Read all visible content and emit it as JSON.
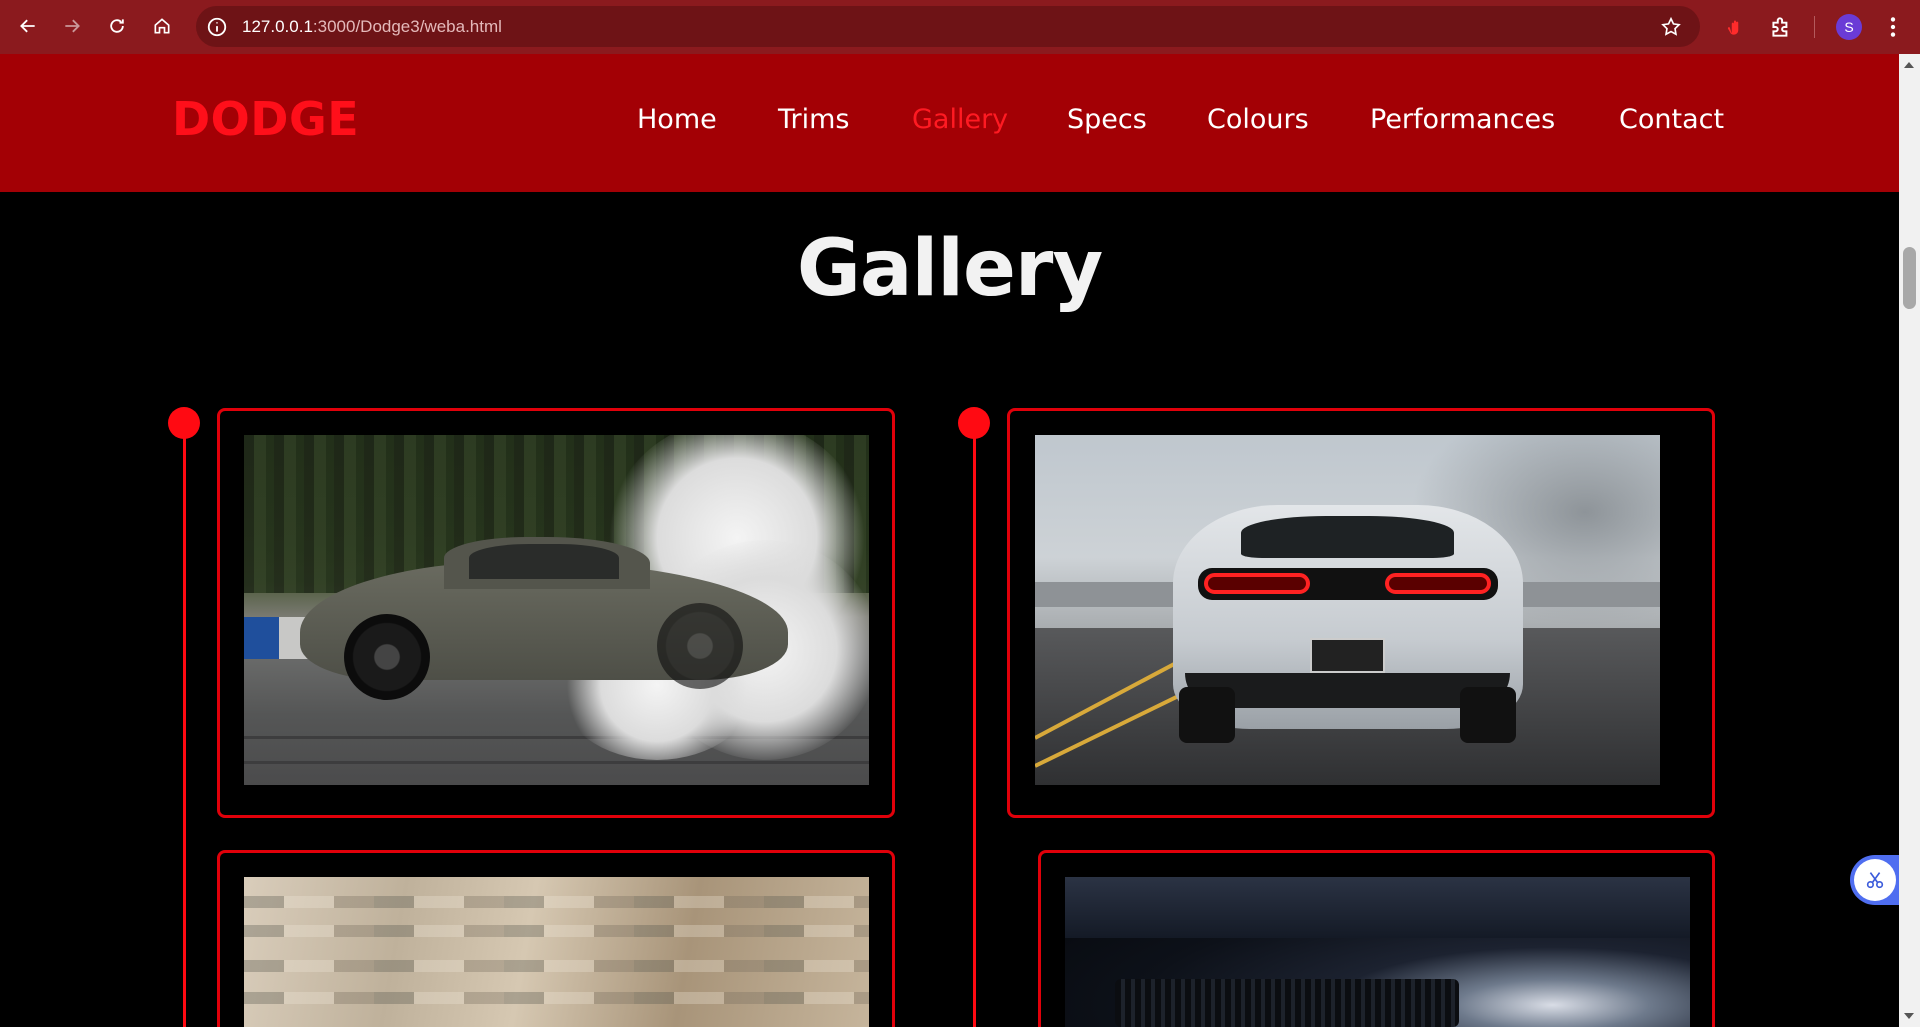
{
  "browser": {
    "url_host": "127.0.0.1",
    "url_rest": ":3000/Dodge3/weba.html",
    "profile_initial": "S"
  },
  "site": {
    "logo": "DODGE",
    "nav": [
      {
        "label": "Home",
        "active": false
      },
      {
        "label": "Trims",
        "active": false
      },
      {
        "label": "Gallery",
        "active": true
      },
      {
        "label": "Specs",
        "active": false
      },
      {
        "label": "Colours",
        "active": false
      },
      {
        "label": "Performances",
        "active": false
      },
      {
        "label": "Contact",
        "active": false
      }
    ],
    "section_title": "Gallery"
  },
  "gallery": {
    "images": [
      {
        "subject": "challenger-burnout-side-view"
      },
      {
        "subject": "challenger-rear-view-on-road"
      },
      {
        "subject": "motion-blur-dusty-ground"
      },
      {
        "subject": "headlight-closeup"
      }
    ]
  },
  "colors": {
    "header_bg": "#a30005",
    "accent_red": "#ff0a12",
    "page_bg": "#000000",
    "chrome_bg": "#8b1a1e"
  }
}
